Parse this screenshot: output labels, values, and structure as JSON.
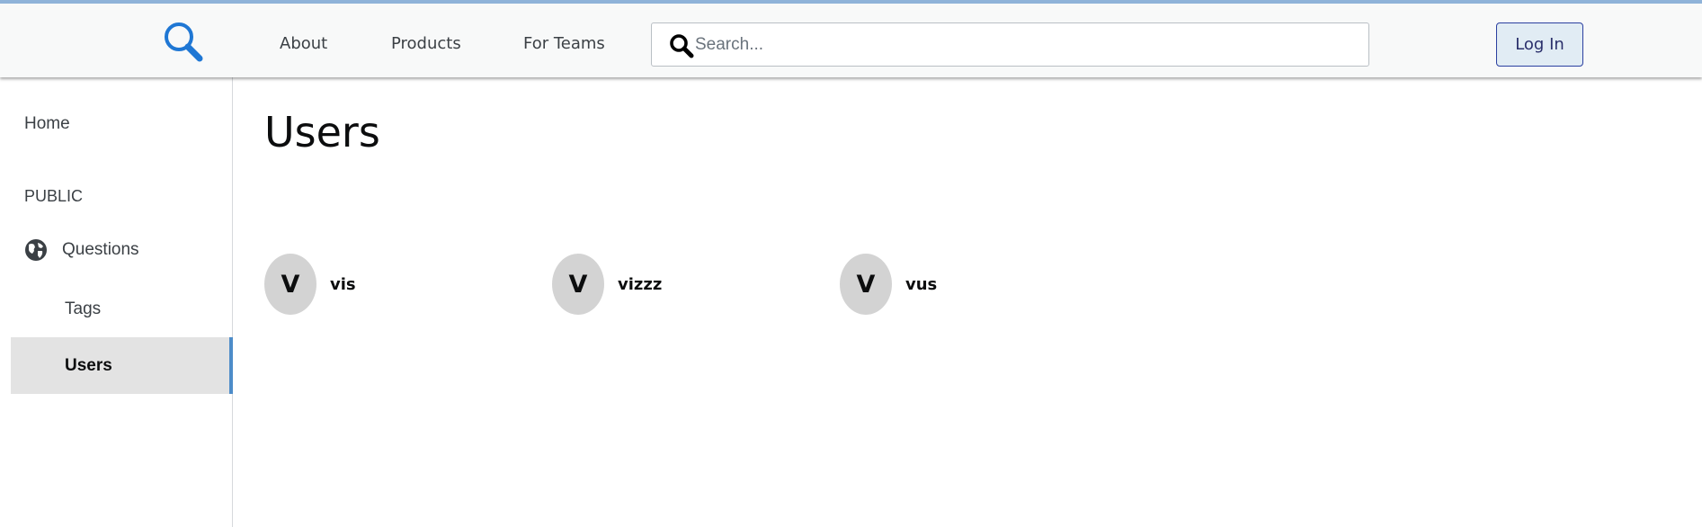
{
  "header": {
    "logo_icon": "magnifier-logo-icon",
    "nav": [
      "About",
      "Products",
      "For Teams"
    ],
    "search": {
      "icon": "search-icon",
      "placeholder": "Search...",
      "value": ""
    },
    "login_label": "Log In"
  },
  "sidebar": {
    "home_label": "Home",
    "section_heading": "PUBLIC",
    "items": [
      {
        "label": "Questions",
        "icon": "globe-icon"
      },
      {
        "label": "Tags"
      },
      {
        "label": "Users",
        "active": true
      }
    ]
  },
  "main": {
    "title": "Users",
    "users": [
      {
        "initial": "V",
        "name": "vis"
      },
      {
        "initial": "V",
        "name": "vizzz"
      },
      {
        "initial": "V",
        "name": "vus"
      }
    ]
  },
  "colors": {
    "accent_blue": "#1f77d4",
    "active_indicator": "#4d8cc9",
    "header_background": "#f8f9f9",
    "avatar_background": "#d3d3d3"
  }
}
